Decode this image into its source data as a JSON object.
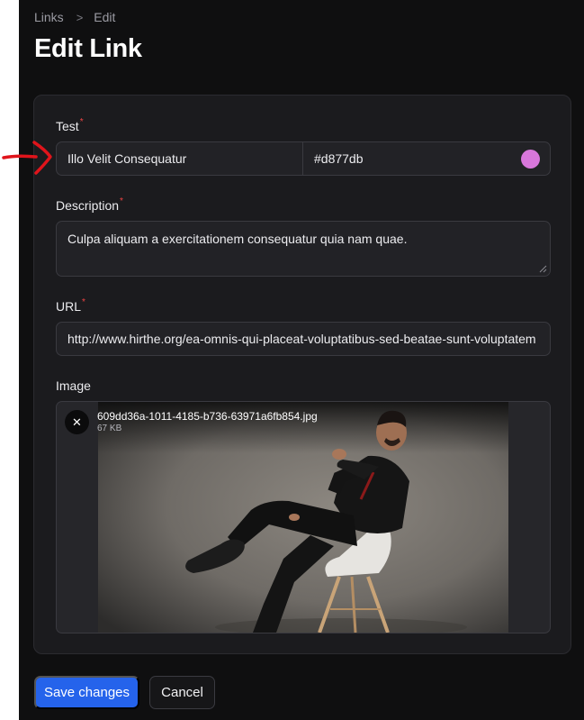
{
  "breadcrumb": {
    "items": [
      "Links",
      "Edit"
    ],
    "separator": ">"
  },
  "page_title": "Edit Link",
  "form": {
    "title": {
      "label": "Test",
      "value": "Illo Velit Consequatur",
      "color_value": "#d877db"
    },
    "description": {
      "label": "Description",
      "value": "Culpa aliquam a exercitationem consequatur quia nam quae."
    },
    "url": {
      "label": "URL",
      "value": "http://www.hirthe.org/ea-omnis-qui-placeat-voluptatibus-sed-beatae-sunt-voluptatem"
    },
    "image": {
      "label": "Image",
      "file_name": "609dd36a-1011-4185-b736-63971a6fb854.jpg",
      "file_size": "67 KB",
      "remove_icon": "close-icon"
    },
    "required_marker": "*"
  },
  "actions": {
    "save_label": "Save changes",
    "cancel_label": "Cancel"
  },
  "colors": {
    "accent": "#2563eb",
    "swatch": "#d877db",
    "required": "#ef4444",
    "annotation": "#e0141b"
  }
}
